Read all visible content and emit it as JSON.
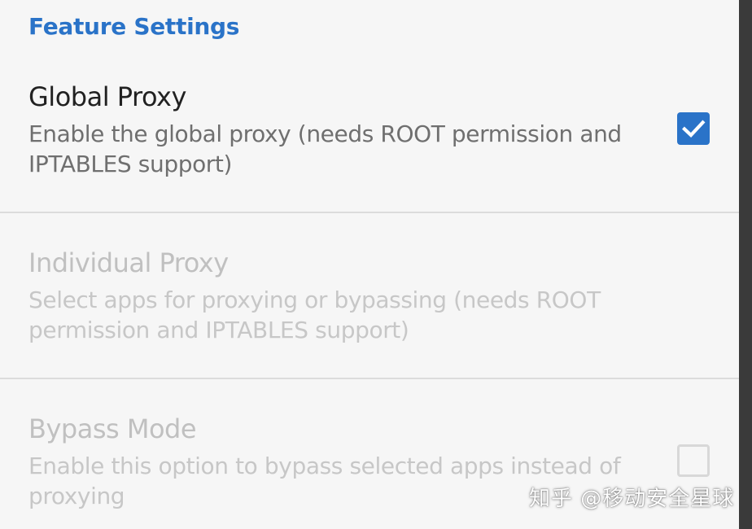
{
  "section": {
    "title": "Feature Settings"
  },
  "prefs": [
    {
      "title": "Global Proxy",
      "summary": "Enable the global proxy (needs ROOT permission and IPTABLES support)",
      "checked": true,
      "enabled": true
    },
    {
      "title": "Individual Proxy",
      "summary": "Select apps for proxying or bypassing (needs ROOT permission and IPTABLES support)",
      "enabled": false
    },
    {
      "title": "Bypass Mode",
      "summary": "Enable this option to bypass selected apps instead of proxying",
      "checked": false,
      "enabled": false
    }
  ],
  "watermark": {
    "text": "知乎 @移动安全星球"
  },
  "colors": {
    "accent": "#2a73c8",
    "background": "#f6f6f6",
    "divider": "#dcdcdc"
  }
}
